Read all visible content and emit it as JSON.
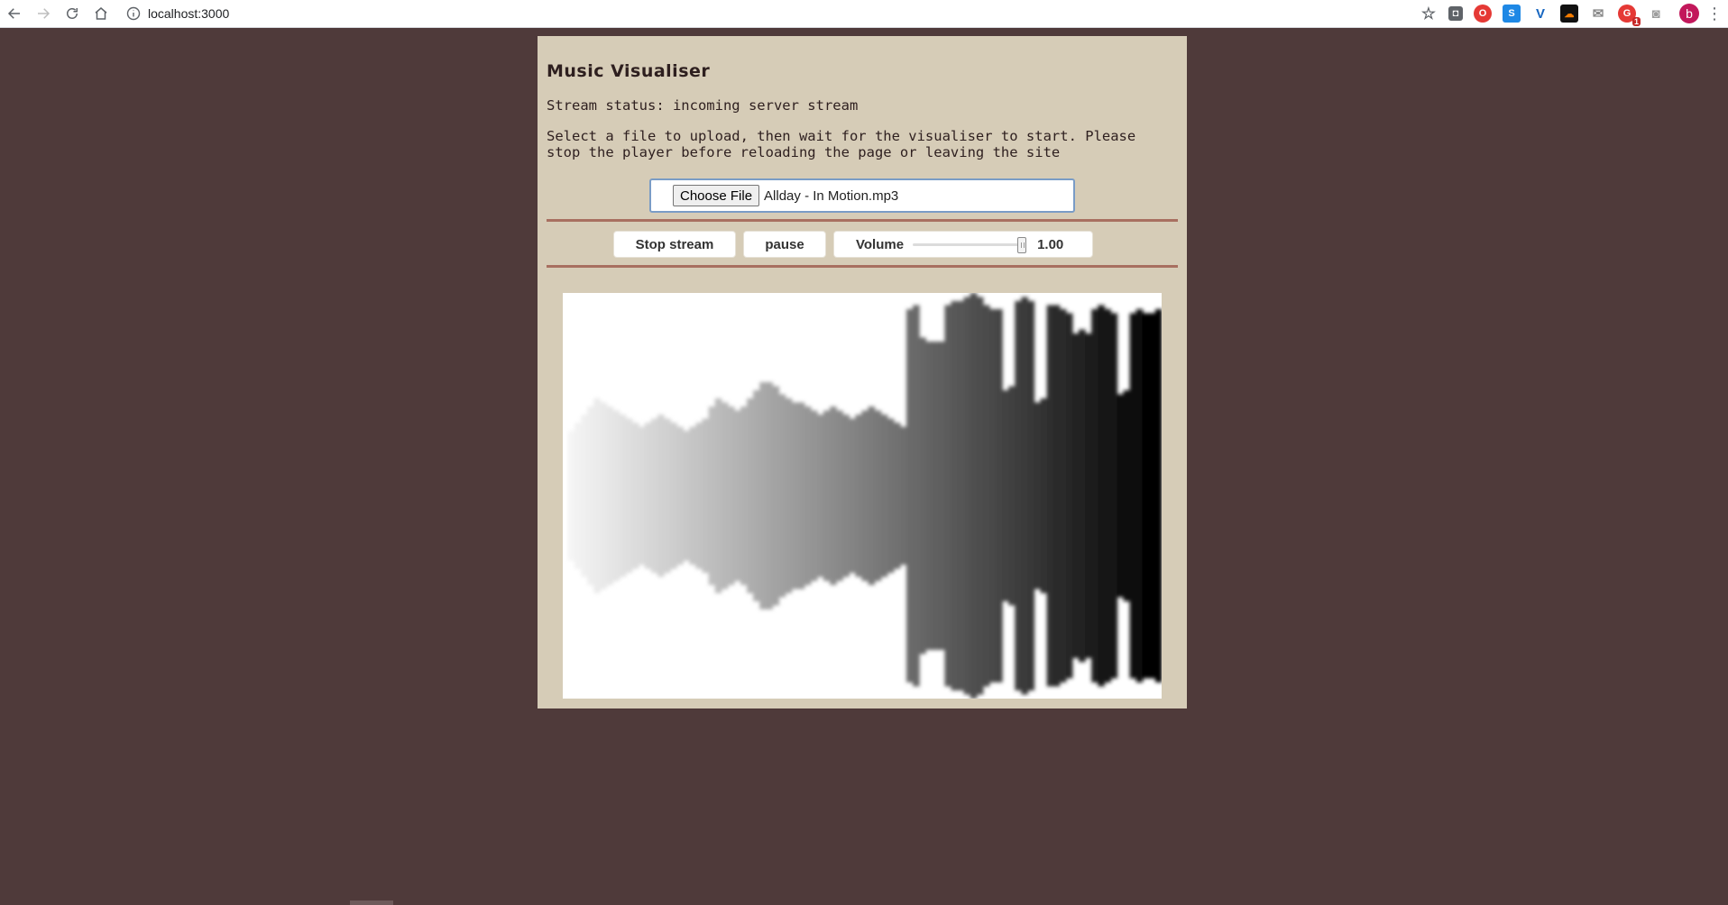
{
  "browser": {
    "url": "localhost:3000",
    "avatar_letter": "b",
    "extensions": [
      "shield-extension",
      "opera-extension",
      "s-extension",
      "vue-extension",
      "soundcloud-extension",
      "mail-extension",
      "notification-extension",
      "camera-extension"
    ],
    "notification_badge": "1"
  },
  "app": {
    "title": "Music Visualiser",
    "status": "Stream status: incoming server stream",
    "instructions": "Select a file to upload, then wait for the visualiser to start. Please stop the player before reloading the page or leaving the site",
    "file_button_label": "Choose File",
    "file_name": "Allday - In Motion.mp3",
    "stop_label": "Stop stream",
    "pause_label": "pause",
    "volume_label": "Volume",
    "volume_value": "1.00",
    "volume_level": 1.0
  },
  "visualiser": {
    "colors": {
      "start": "#f4f4f4",
      "end": "#000000",
      "background": "#ffffff"
    },
    "bars": [
      0.16,
      0.18,
      0.2,
      0.22,
      0.24,
      0.23,
      0.22,
      0.21,
      0.2,
      0.19,
      0.18,
      0.17,
      0.18,
      0.19,
      0.2,
      0.19,
      0.18,
      0.17,
      0.16,
      0.17,
      0.18,
      0.19,
      0.22,
      0.24,
      0.23,
      0.22,
      0.21,
      0.22,
      0.24,
      0.26,
      0.28,
      0.28,
      0.27,
      0.25,
      0.24,
      0.23,
      0.23,
      0.22,
      0.21,
      0.2,
      0.21,
      0.22,
      0.21,
      0.2,
      0.19,
      0.2,
      0.21,
      0.22,
      0.21,
      0.2,
      0.19,
      0.18,
      0.17,
      0.46,
      0.47,
      0.39,
      0.38,
      0.38,
      0.38,
      0.47,
      0.48,
      0.48,
      0.49,
      0.5,
      0.49,
      0.47,
      0.46,
      0.46,
      0.26,
      0.27,
      0.48,
      0.49,
      0.48,
      0.23,
      0.24,
      0.47,
      0.47,
      0.46,
      0.45,
      0.4,
      0.41,
      0.4,
      0.46,
      0.47,
      0.46,
      0.45,
      0.25,
      0.26,
      0.45,
      0.46,
      0.45,
      0.45,
      0.46
    ]
  }
}
